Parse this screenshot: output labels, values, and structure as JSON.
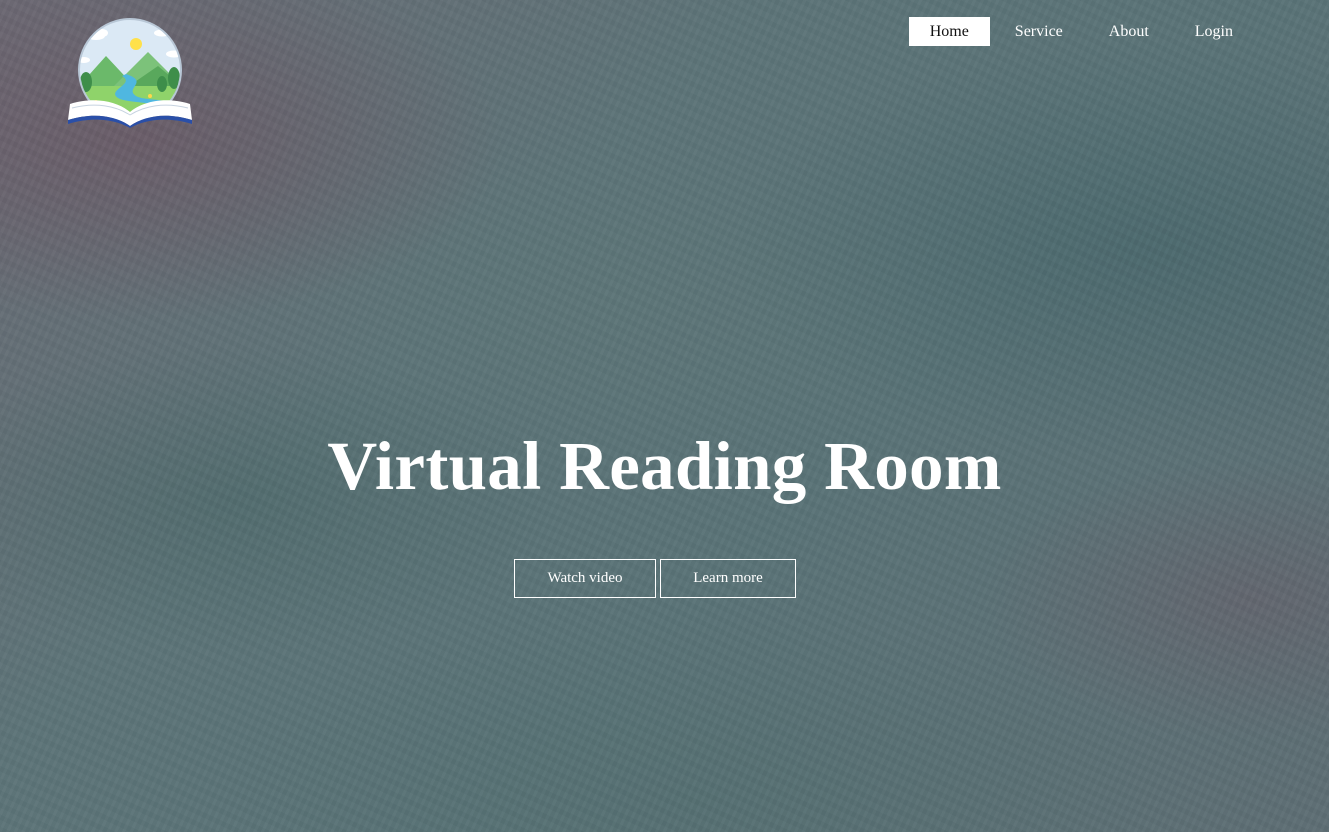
{
  "brand": {
    "logo_icon": "book-landscape-logo-icon"
  },
  "nav": {
    "items": [
      {
        "label": "Home",
        "active": true
      },
      {
        "label": "Service",
        "active": false
      },
      {
        "label": "About",
        "active": false
      },
      {
        "label": "Login",
        "active": false
      }
    ]
  },
  "hero": {
    "title": "Virtual Reading Room",
    "watch_label": "Watch video",
    "learn_label": "Learn more"
  },
  "colors": {
    "text": "#ffffff",
    "active_nav_bg": "#ffffff",
    "active_nav_text": "#111111",
    "background": "#5d7478"
  }
}
